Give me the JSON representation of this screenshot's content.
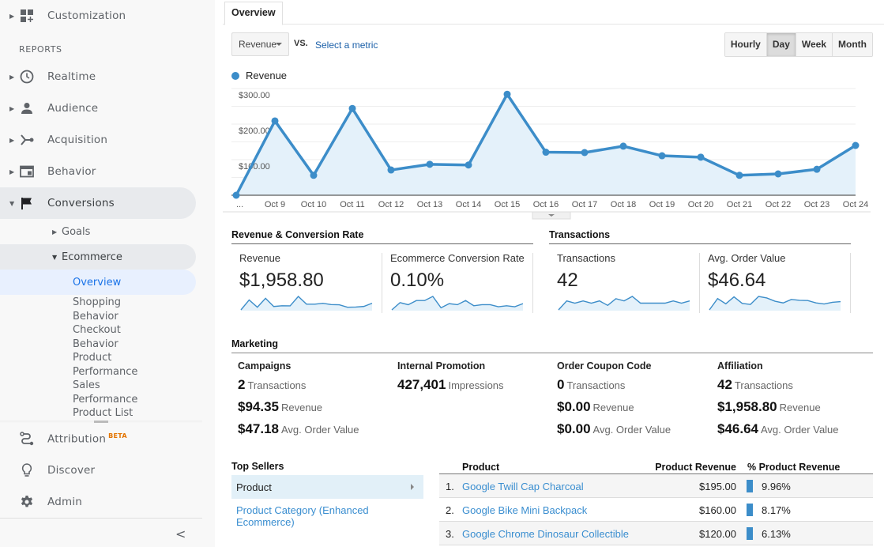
{
  "sidebar": {
    "customization": "Customization",
    "reports_header": "REPORTS",
    "items": [
      {
        "label": "Realtime",
        "icon": "clock-icon"
      },
      {
        "label": "Audience",
        "icon": "person-icon"
      },
      {
        "label": "Acquisition",
        "icon": "acquisition-icon"
      },
      {
        "label": "Behavior",
        "icon": "behavior-icon"
      },
      {
        "label": "Conversions",
        "icon": "flag-icon"
      }
    ],
    "goals": "Goals",
    "ecommerce": "Ecommerce",
    "ecommerce_children": [
      "Overview",
      "Shopping",
      "Behavior",
      "Checkout",
      "Behavior",
      "Product",
      "Performance",
      "Sales",
      "Performance",
      "Product List"
    ],
    "attribution": "Attribution",
    "beta_badge": "BETA",
    "discover": "Discover",
    "admin": "Admin",
    "collapse": "<"
  },
  "main": {
    "tab": "Overview",
    "metric_select": "Revenue",
    "vs_label": "VS.",
    "select_metric": "Select a metric",
    "granularity": [
      "Hourly",
      "Day",
      "Week",
      "Month"
    ],
    "granularity_selected": "Day",
    "legend": "Revenue"
  },
  "chart_data": {
    "type": "area",
    "title": "",
    "series": [
      {
        "name": "Revenue",
        "color": "#3c8dc9",
        "values": [
          0,
          209,
          56,
          244,
          71,
          87,
          85,
          284,
          121,
          120,
          138,
          111,
          107,
          56,
          60,
          73,
          140
        ]
      }
    ],
    "x": [
      "...",
      "Oct 9",
      "Oct 10",
      "Oct 11",
      "Oct 12",
      "Oct 13",
      "Oct 14",
      "Oct 15",
      "Oct 16",
      "Oct 17",
      "Oct 18",
      "Oct 19",
      "Oct 20",
      "Oct 21",
      "Oct 22",
      "Oct 23",
      "Oct 24"
    ],
    "ytick_labels": [
      "$100.00",
      "$200.00",
      "$300.00"
    ],
    "yticks": [
      100,
      200,
      300
    ],
    "ylim": [
      0,
      300
    ],
    "grid": true,
    "xlabel": "",
    "ylabel": ""
  },
  "rev_conv": {
    "title": "Revenue & Conversion Rate",
    "cards": [
      {
        "label": "Revenue",
        "value": "$1,958.80",
        "spark": [
          0,
          209,
          56,
          244,
          71,
          87,
          85,
          284,
          121,
          120,
          138,
          111,
          107,
          56,
          60,
          73,
          140
        ]
      },
      {
        "label": "Ecommerce Conversion Rate",
        "value": "0.10%",
        "spark": [
          0.02,
          0.09,
          0.07,
          0.11,
          0.11,
          0.15,
          0.04,
          0.08,
          0.07,
          0.11,
          0.06,
          0.07,
          0.07,
          0.05,
          0.06,
          0.05,
          0.08
        ]
      }
    ]
  },
  "transactions": {
    "title": "Transactions",
    "cards": [
      {
        "label": "Transactions",
        "value": "42",
        "spark": [
          0,
          4,
          3,
          4,
          3,
          4,
          2,
          5,
          4,
          6,
          3,
          3,
          3,
          3,
          4,
          3,
          4
        ]
      },
      {
        "label": "Avg. Order Value",
        "value": "$46.64",
        "spark": [
          0,
          52,
          28,
          60,
          30,
          25,
          62,
          55,
          40,
          32,
          48,
          44,
          43,
          32,
          27,
          35,
          38
        ]
      }
    ]
  },
  "marketing": {
    "title": "Marketing",
    "groups": [
      {
        "title": "Campaigns",
        "rows": [
          {
            "value": "2",
            "label": "Transactions"
          },
          {
            "value": "$94.35",
            "label": "Revenue"
          },
          {
            "value": "$47.18",
            "label": "Avg. Order Value"
          }
        ]
      },
      {
        "title": "Internal Promotion",
        "rows": [
          {
            "value": "427,401",
            "label": "Impressions"
          }
        ]
      },
      {
        "title": "Order Coupon Code",
        "rows": [
          {
            "value": "0",
            "label": "Transactions"
          },
          {
            "value": "$0.00",
            "label": "Revenue"
          },
          {
            "value": "$0.00",
            "label": "Avg. Order Value"
          }
        ]
      },
      {
        "title": "Affiliation",
        "rows": [
          {
            "value": "42",
            "label": "Transactions"
          },
          {
            "value": "$1,958.80",
            "label": "Revenue"
          },
          {
            "value": "$46.64",
            "label": "Avg. Order Value"
          }
        ]
      }
    ]
  },
  "top_sellers": {
    "title": "Top Sellers",
    "selected": "Product",
    "other": "Product Category (Enhanced Ecommerce)"
  },
  "products": {
    "headers": {
      "product": "Product",
      "revenue": "Product Revenue",
      "pct": "% Product Revenue"
    },
    "rows": [
      {
        "num": "1.",
        "name": "Google Twill Cap Charcoal",
        "revenue": "$195.00",
        "pct": "9.96%"
      },
      {
        "num": "2.",
        "name": "Google Bike Mini Backpack",
        "revenue": "$160.00",
        "pct": "8.17%"
      },
      {
        "num": "3.",
        "name": "Google Chrome Dinosaur Collectible",
        "revenue": "$120.00",
        "pct": "6.13%"
      }
    ]
  }
}
